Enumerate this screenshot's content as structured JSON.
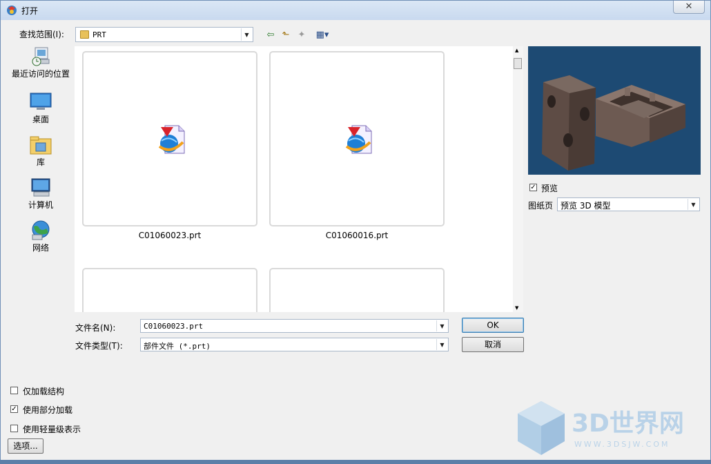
{
  "window": {
    "title": "打开",
    "close_glyph": "✕"
  },
  "look_in": {
    "label": "查找范围(I):",
    "value": "PRT"
  },
  "toolbar": [
    {
      "name": "back-arrow-icon",
      "glyph": "⇦",
      "color": "#2a7a2a"
    },
    {
      "name": "up-folder-icon",
      "glyph": "⬑",
      "color": "#a57a1a"
    },
    {
      "name": "new-folder-icon",
      "glyph": "✦",
      "color": "#9a9a9a"
    },
    {
      "name": "view-menu-icon",
      "glyph": "▦▾",
      "color": "#2b4f8a"
    }
  ],
  "places": [
    {
      "label": "最近访问的位置",
      "icon": "recent-places-icon"
    },
    {
      "label": "桌面",
      "icon": "desktop-icon"
    },
    {
      "label": "库",
      "icon": "libraries-icon"
    },
    {
      "label": "计算机",
      "icon": "computer-icon"
    },
    {
      "label": "网络",
      "icon": "network-icon"
    }
  ],
  "files": [
    {
      "name": "C01060023.prt"
    },
    {
      "name": "C01060016.prt"
    },
    {
      "name": ""
    },
    {
      "name": ""
    }
  ],
  "preview": {
    "checkbox_label": "预览",
    "checked": true,
    "sheet_label": "图纸页",
    "sheet_value": "预览 3D 模型"
  },
  "filename": {
    "label": "文件名(N):",
    "value": "C01060023.prt"
  },
  "filetype": {
    "label": "文件类型(T):",
    "value": "部件文件 (*.prt)"
  },
  "buttons": {
    "ok": "OK",
    "cancel": "取消",
    "options": "选项..."
  },
  "options": [
    {
      "label": "仅加载结构",
      "checked": false
    },
    {
      "label": "使用部分加载",
      "checked": true
    },
    {
      "label": "使用轻量级表示",
      "checked": false
    }
  ],
  "watermark": {
    "text": "3D世界网",
    "url": "WWW.3DSJW.COM"
  }
}
